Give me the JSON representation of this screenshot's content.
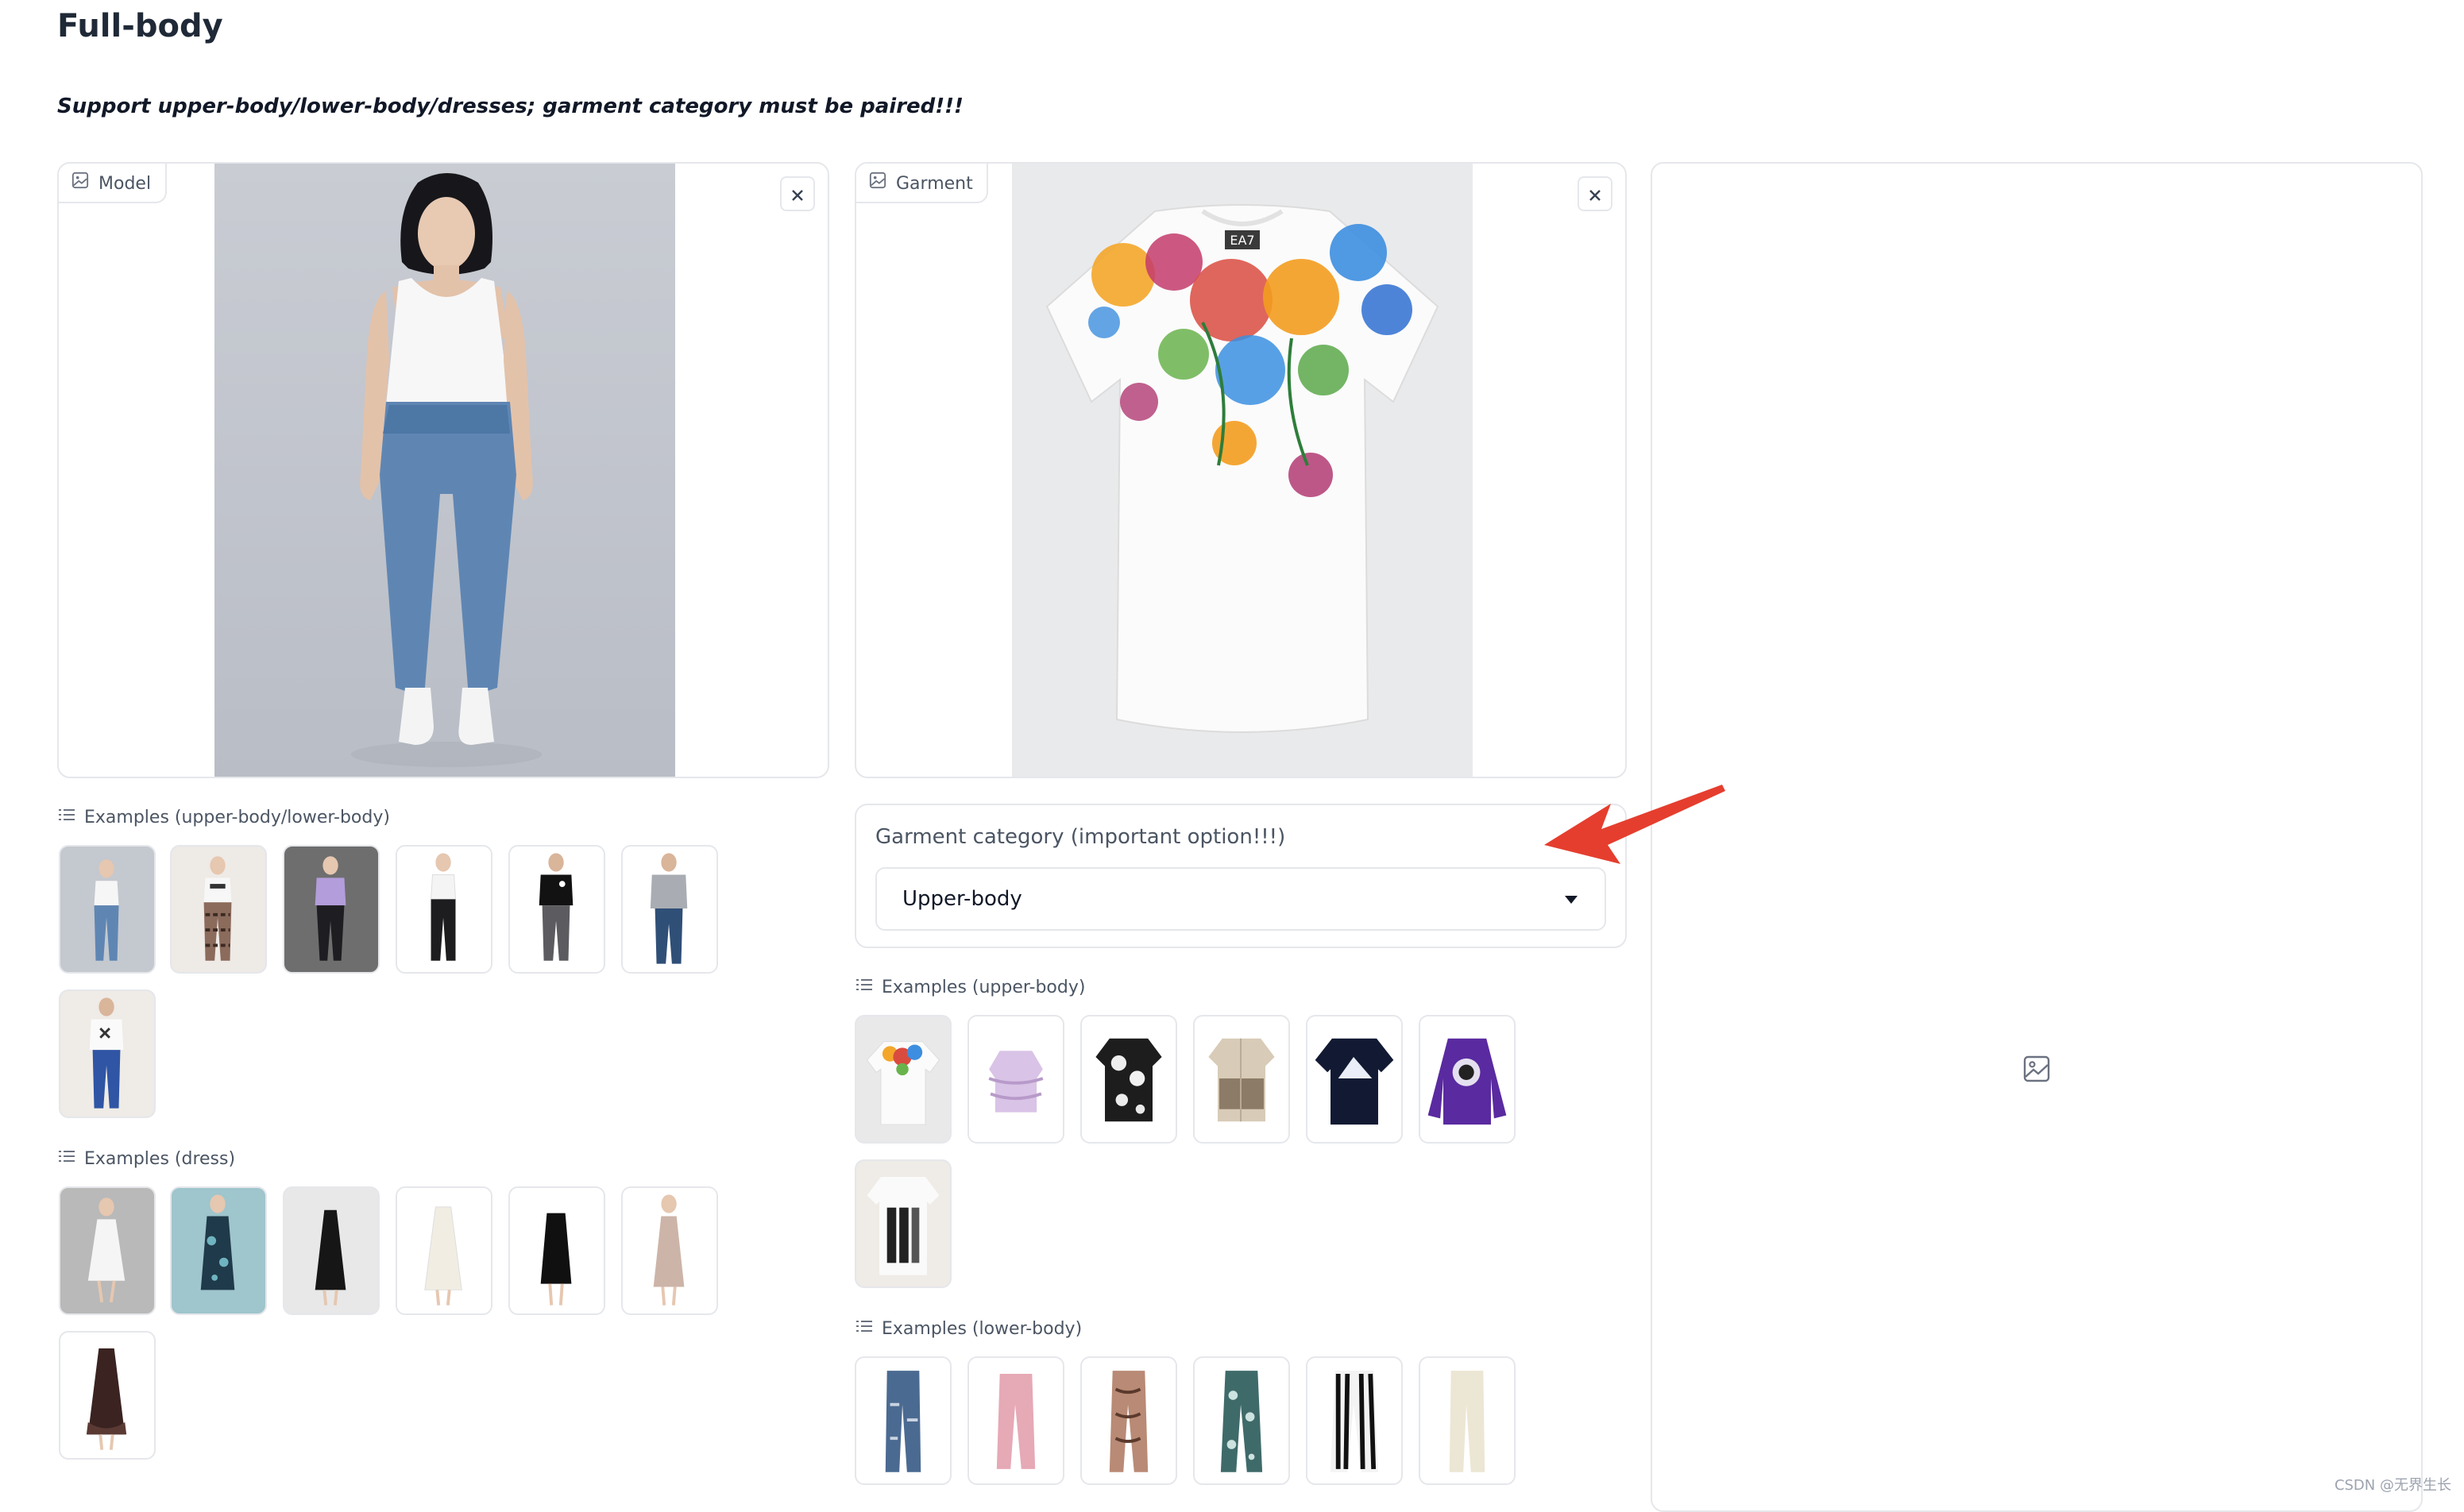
{
  "page": {
    "title": "Full-body",
    "subtitle": "Support upper-body/lower-body/dresses; garment category must be paired!!!"
  },
  "model_panel": {
    "label": "Model",
    "icon": "image-icon",
    "close_icon": "close-icon"
  },
  "garment_panel": {
    "label": "Garment",
    "icon": "image-icon",
    "close_icon": "close-icon",
    "brand_tag": "EA7"
  },
  "output_panel": {
    "placeholder_icon": "image-icon"
  },
  "examples_upper_lower": {
    "label": "Examples (upper-body/lower-body)",
    "items": [
      "example-1",
      "example-2",
      "example-3",
      "example-4",
      "example-5",
      "example-6",
      "example-7"
    ]
  },
  "examples_dress": {
    "label": "Examples (dress)",
    "items": [
      "example-1",
      "example-2",
      "example-3",
      "example-4",
      "example-5",
      "example-6",
      "example-7"
    ]
  },
  "garment_category": {
    "label": "Garment category (important option!!!)",
    "selected": "Upper-body"
  },
  "examples_upper_body": {
    "label": "Examples (upper-body)",
    "items": [
      "example-1",
      "example-2",
      "example-3",
      "example-4",
      "example-5",
      "example-6",
      "example-7"
    ]
  },
  "examples_lower_body": {
    "label": "Examples (lower-body)",
    "items": [
      "example-1",
      "example-2",
      "example-3",
      "example-4",
      "example-5",
      "example-6"
    ]
  },
  "watermark": "CSDN @无界生长",
  "colors": {
    "accent_arrow": "#e53e2e",
    "border": "#e5e7eb",
    "text": "#27272a"
  }
}
